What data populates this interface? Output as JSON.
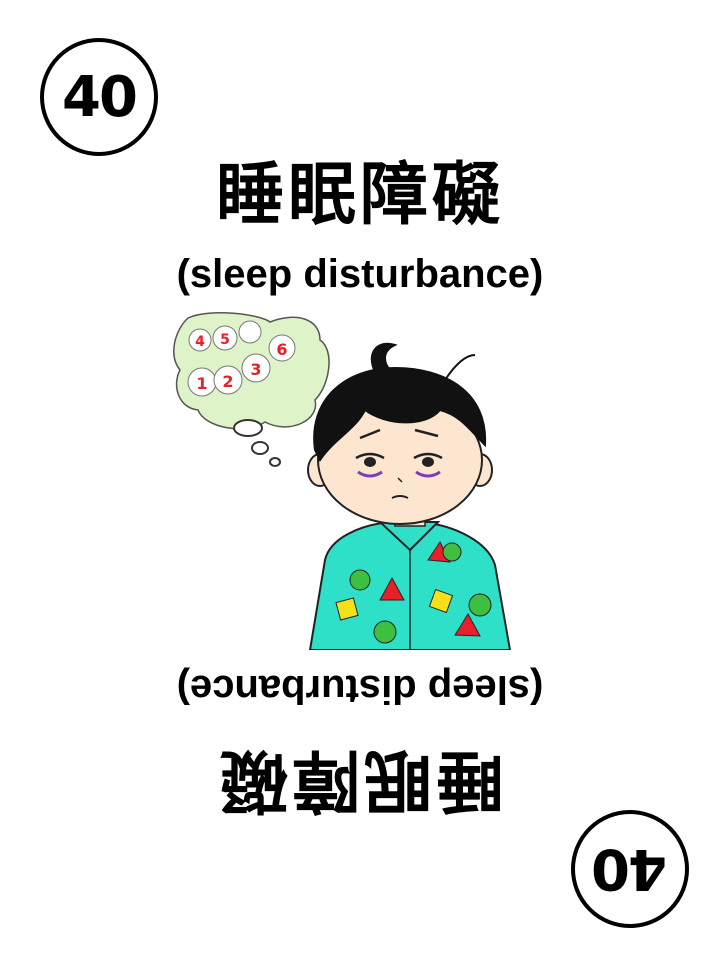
{
  "card": {
    "number": "40",
    "title_cn": "睡眠障礙",
    "title_en": "(sleep disturbance)"
  },
  "illustration": {
    "sheep_numbers": [
      "1",
      "2",
      "3",
      "4",
      "5",
      "6"
    ],
    "colors": {
      "shirt": "#2ee0c8",
      "hair": "#111111",
      "skin": "#fde6cf",
      "thought_bubble": "#dff3c8",
      "dot_green": "#3fbf3f",
      "triangle_red": "#e8202a",
      "square_yellow": "#f5e11a",
      "number_red": "#e8202a"
    }
  }
}
